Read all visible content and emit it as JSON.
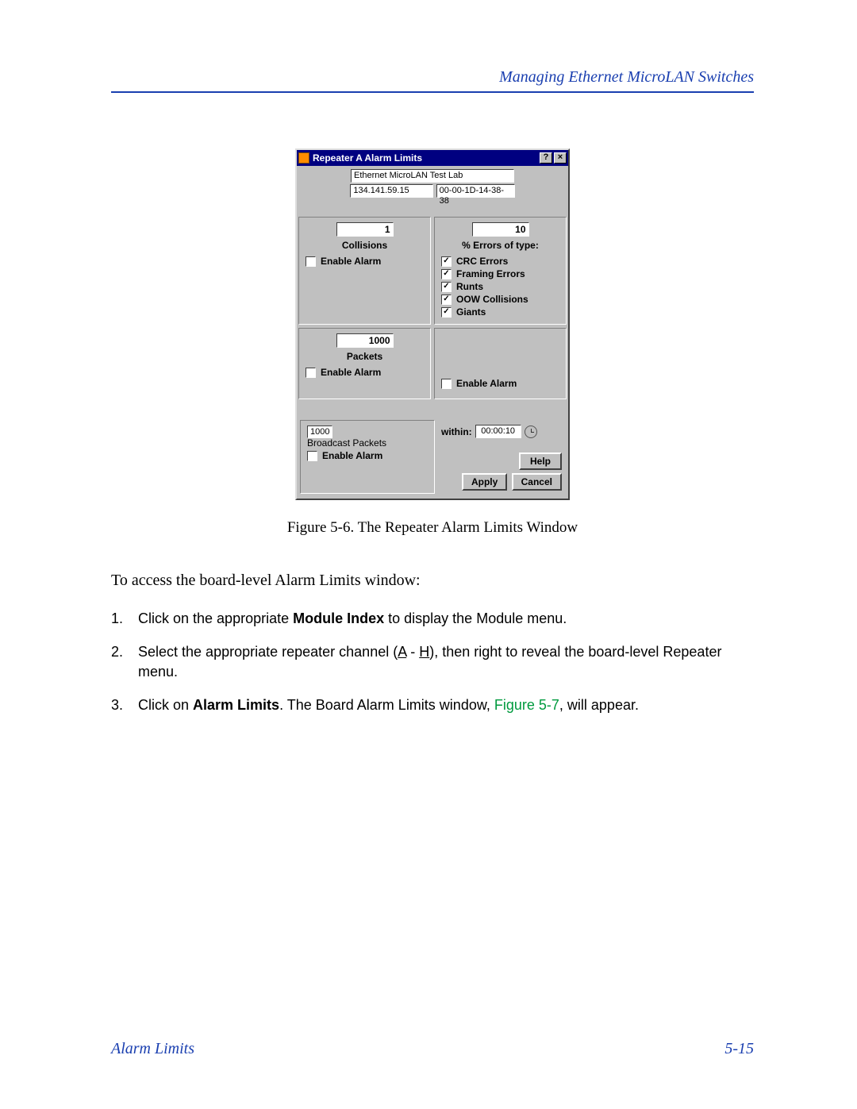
{
  "header": {
    "section_title": "Managing Ethernet MicroLAN Switches"
  },
  "dialog": {
    "title": "Repeater A Alarm Limits",
    "help_glyph": "?",
    "close_glyph": "×",
    "device_name": "Ethernet MicroLAN Test Lab",
    "ip": "134.141.59.15",
    "mac": "00-00-1D-14-38-38",
    "collisions": {
      "value": "1",
      "label": "Collisions",
      "enable_label": "Enable Alarm"
    },
    "errors": {
      "value": "10",
      "label": "% Errors of type:",
      "types": [
        {
          "label": "CRC Errors",
          "checked": true
        },
        {
          "label": "Framing Errors",
          "checked": true
        },
        {
          "label": "Runts",
          "checked": true
        },
        {
          "label": "OOW Collisions",
          "checked": true
        },
        {
          "label": "Giants",
          "checked": true
        }
      ],
      "enable_label": "Enable Alarm"
    },
    "packets": {
      "value": "1000",
      "label": "Packets",
      "enable_label": "Enable Alarm"
    },
    "broadcast": {
      "value": "1000",
      "label": "Broadcast Packets",
      "enable_label": "Enable Alarm"
    },
    "within": {
      "label": "within:",
      "value": "00:00:10"
    },
    "buttons": {
      "help": "Help",
      "apply": "Apply",
      "cancel": "Cancel"
    }
  },
  "figure": {
    "caption": "Figure 5-6. The Repeater Alarm Limits Window"
  },
  "body": {
    "intro": "To access the board-level Alarm Limits window:",
    "steps": {
      "s1_a": "Click on the appropriate ",
      "s1_b": "Module Index",
      "s1_c": " to display the Module menu.",
      "s2_a": "Select the appropriate repeater channel (",
      "s2_b": "A",
      "s2_c": " - ",
      "s2_d": "H",
      "s2_e": "), then right to reveal the board-level Repeater menu.",
      "s3_a": "Click on ",
      "s3_b": "Alarm Limits",
      "s3_c": ". The Board Alarm Limits window, ",
      "s3_d": "Figure 5-7",
      "s3_e": ", will appear."
    }
  },
  "footer": {
    "left": "Alarm Limits",
    "right": "5-15"
  }
}
